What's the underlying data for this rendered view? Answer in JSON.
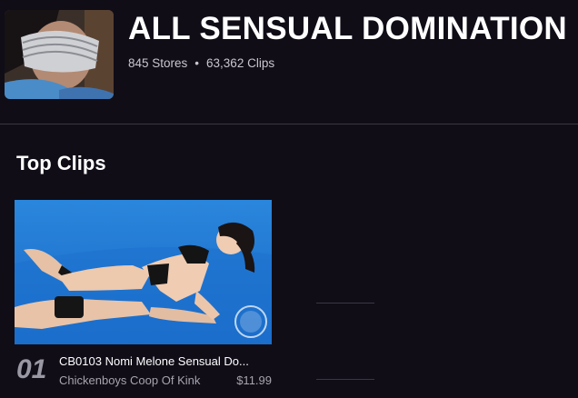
{
  "category": {
    "title": "ALL SENSUAL DOMINATION",
    "stores": "845 Stores",
    "separator": "•",
    "clips": "63,362 Clips"
  },
  "top_clips": {
    "heading": "Top Clips",
    "items": [
      {
        "rank": "01",
        "title": "CB0103 Nomi Melone Sensual Do...",
        "store": "Chickenboys Coop Of Kink",
        "price": "$11.99"
      }
    ]
  },
  "colors": {
    "background": "#100d17",
    "divider": "#3a3644",
    "muted_text": "#a7a4ae",
    "clip_backdrop": "#1f7ad4"
  },
  "icons": {
    "category_thumbnail": "category-thumbnail-image",
    "clip_thumbnail": "clip-thumbnail-image",
    "watermark": "watermark-logo-icon"
  }
}
